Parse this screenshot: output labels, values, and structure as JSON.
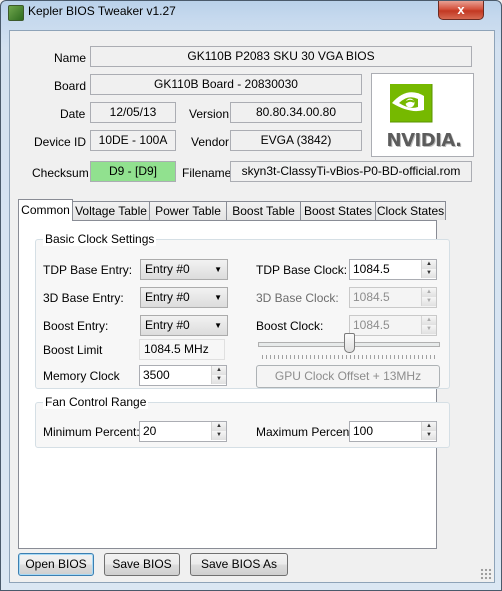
{
  "window": {
    "title": "Kepler BIOS Tweaker v1.27",
    "close_glyph": "x"
  },
  "info": {
    "name_label": "Name",
    "name_value": "GK110B P2083 SKU 30 VGA BIOS",
    "board_label": "Board",
    "board_value": "GK110B Board - 20830030",
    "date_label": "Date",
    "date_value": "12/05/13",
    "version_label": "Version",
    "version_value": "80.80.34.00.80",
    "device_label": "Device ID",
    "device_value": "10DE - 100A",
    "vendor_label": "Vendor",
    "vendor_value": "EVGA (3842)",
    "checksum_label": "Checksum",
    "checksum_value": "D9 - [D9]",
    "filename_label": "Filename",
    "filename_value": "skyn3t-ClassyTi-vBios-P0-BD-official.rom",
    "logo_text": "NVIDIA."
  },
  "tabs": [
    "Common",
    "Voltage Table",
    "Power Table",
    "Boost Table",
    "Boost States",
    "Clock States"
  ],
  "clock": {
    "group_title": "Basic Clock Settings",
    "tdp_entry_label": "TDP Base Entry:",
    "tdp_entry_value": "Entry #0",
    "base3d_entry_label": "3D Base Entry:",
    "base3d_entry_value": "Entry #0",
    "boost_entry_label": "Boost Entry:",
    "boost_entry_value": "Entry #0",
    "boost_limit_label": "Boost Limit",
    "boost_limit_value": "1084.5 MHz",
    "memory_label": "Memory Clock",
    "memory_value": "3500",
    "tdp_clock_label": "TDP Base Clock:",
    "tdp_clock_value": "1084.5",
    "base3d_clock_label": "3D Base Clock:",
    "base3d_clock_value": "1084.5",
    "boost_clock_label": "Boost Clock:",
    "boost_clock_value": "1084.5",
    "offset_button": "GPU Clock Offset + 13MHz"
  },
  "fan": {
    "group_title": "Fan Control Range",
    "min_label": "Minimum Percent:",
    "min_value": "20",
    "max_label": "Maximum Percent:",
    "max_value": "100"
  },
  "buttons": {
    "open": "Open BIOS",
    "save": "Save BIOS",
    "save_as": "Save BIOS As"
  },
  "icons": {
    "combo_arrow": "▼",
    "spin_up": "▲",
    "spin_down": "▼"
  },
  "colors": {
    "checksum_ok": "#91e18f",
    "nvidia_green": "#76b900"
  }
}
